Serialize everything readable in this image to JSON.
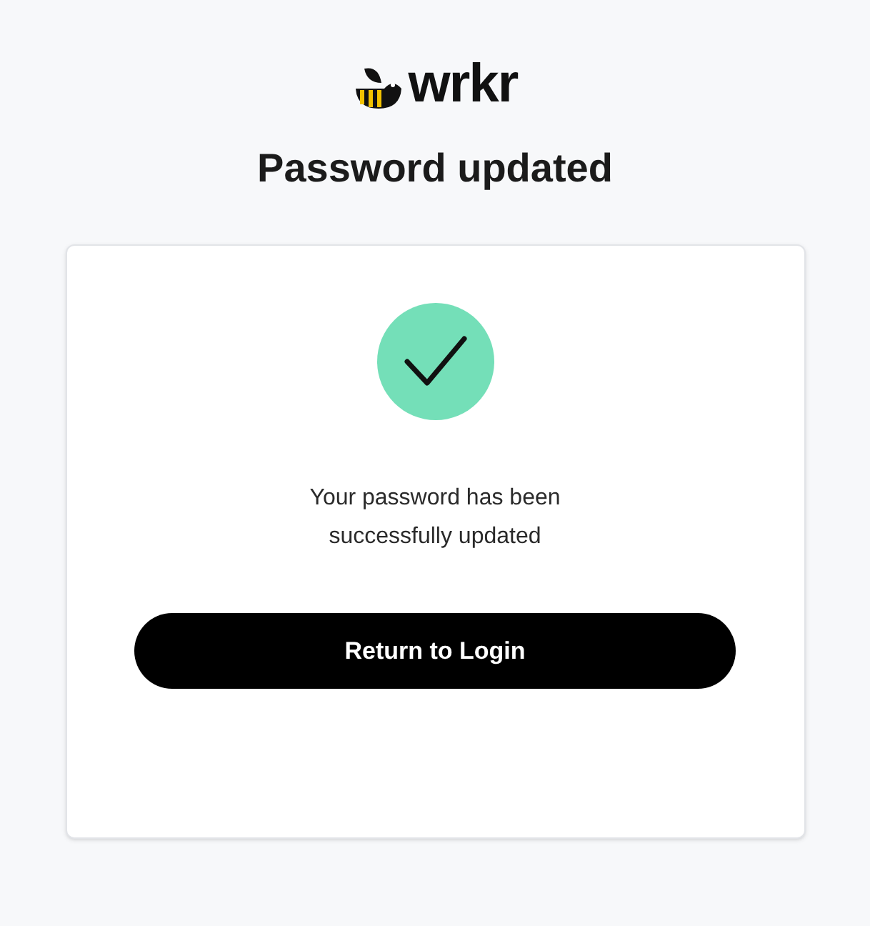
{
  "logo": {
    "text": "wrkr"
  },
  "title": "Password updated",
  "card": {
    "message": "Your password has been successfully updated",
    "button": "Return to Login"
  }
}
